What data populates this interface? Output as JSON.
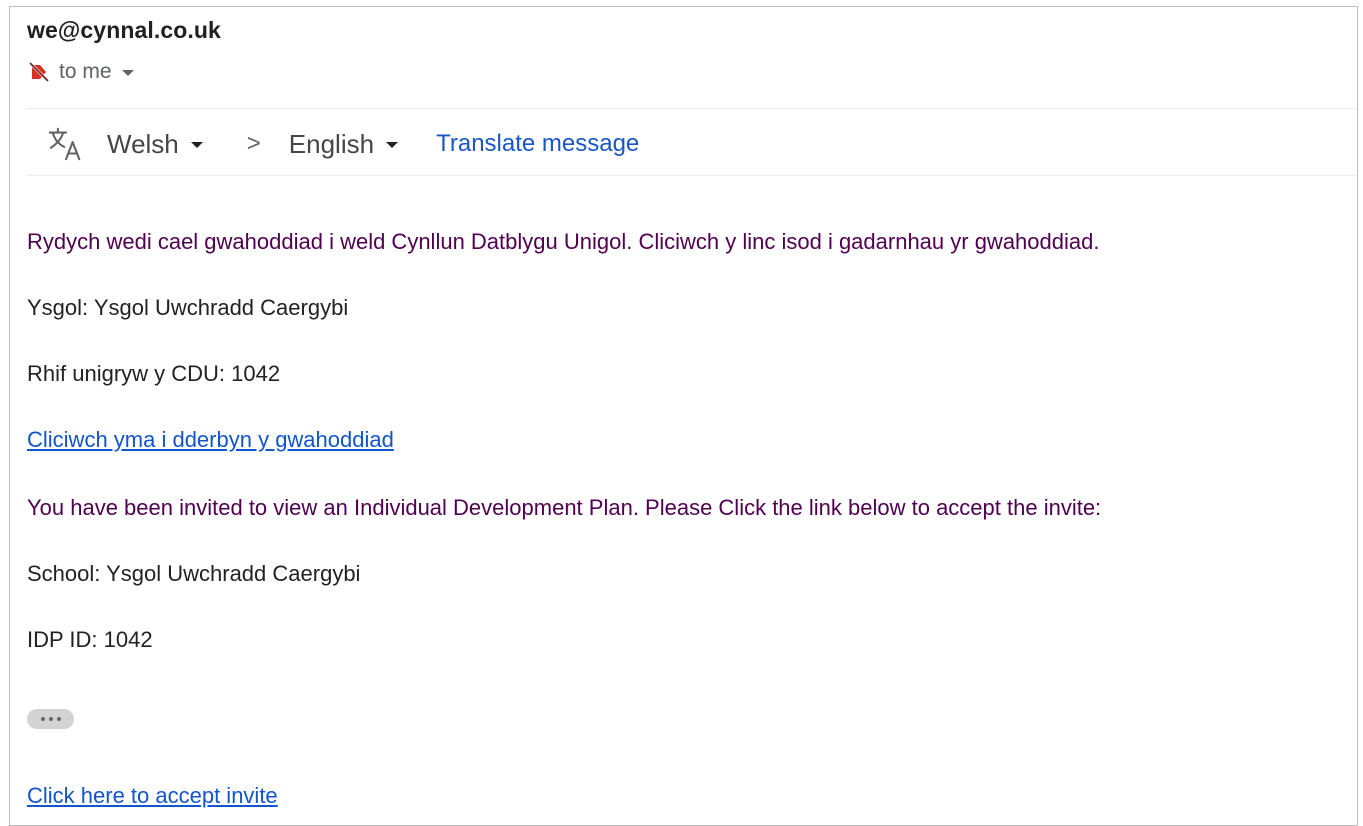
{
  "header": {
    "sender": "we@cynnal.co.uk",
    "recipient_label": "to me"
  },
  "translate_bar": {
    "source_language": "Welsh",
    "target_language": "English",
    "separator": ">",
    "translate_link": "Translate message"
  },
  "message": {
    "welsh_intro": "Rydych wedi cael gwahoddiad i weld Cynllun Datblygu Unigol. Cliciwch y linc isod i gadarnhau yr gwahoddiad.",
    "welsh_school": "Ysgol: Ysgol Uwchradd Caergybi",
    "welsh_id": "Rhif unigryw y CDU: 1042",
    "welsh_link": "Cliciwch yma i dderbyn y gwahoddiad",
    "english_intro": "You have been invited to view an Individual Development Plan. Please Click the link below to accept the invite:",
    "english_school": "School: Ysgol Uwchradd Caergybi",
    "english_id": "IDP ID: 1042",
    "english_link": "Click here to accept invite"
  },
  "icons": {
    "label_icon": "important-label-icon",
    "translate_icon": "translate-icon",
    "expand_icon": "show-trimmed-content-icon"
  },
  "colors": {
    "welsh_text": "#500050",
    "link": "#1155cc",
    "label_icon": "#d93025"
  }
}
